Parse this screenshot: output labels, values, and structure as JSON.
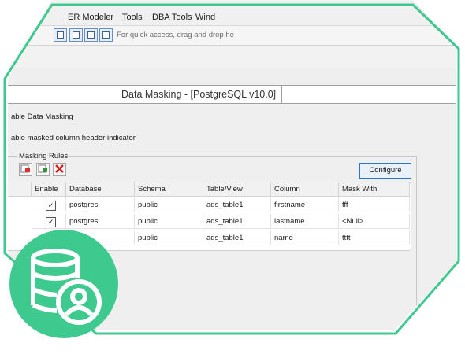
{
  "menubar": {
    "items": [
      "ER Modeler",
      "Tools",
      "DBA Tools",
      "Wind"
    ]
  },
  "toolbar": {
    "hint": "For quick access, drag and drop he"
  },
  "dialog": {
    "title": "Data Masking - [PostgreSQL v10.0]",
    "checkbox_enable": "able Data Masking",
    "checkbox_header_indicator": "able masked column header indicator",
    "group_label": "Masking Rules",
    "configure_label": "Configure"
  },
  "grid": {
    "columns": [
      "Enable",
      "Database",
      "Schema",
      "Table/View",
      "Column",
      "Mask With"
    ],
    "rows": [
      {
        "enable": true,
        "database": "postgres",
        "schema": "public",
        "table": "ads_table1",
        "column": "firstname",
        "mask": "fff"
      },
      {
        "enable": true,
        "database": "postgres",
        "schema": "public",
        "table": "ads_table1",
        "column": "lastname",
        "mask": "<Null>"
      },
      {
        "enable": true,
        "database": "",
        "schema": "public",
        "table": "ads_table1",
        "column": "name",
        "mask": "tttt"
      }
    ]
  },
  "colors": {
    "accent_green": "#3ec98f",
    "checkbox_mark": "✓",
    "add_icon": "add-rule-icon",
    "edit_icon": "edit-rule-icon",
    "delete_icon": "delete-rule-icon"
  }
}
